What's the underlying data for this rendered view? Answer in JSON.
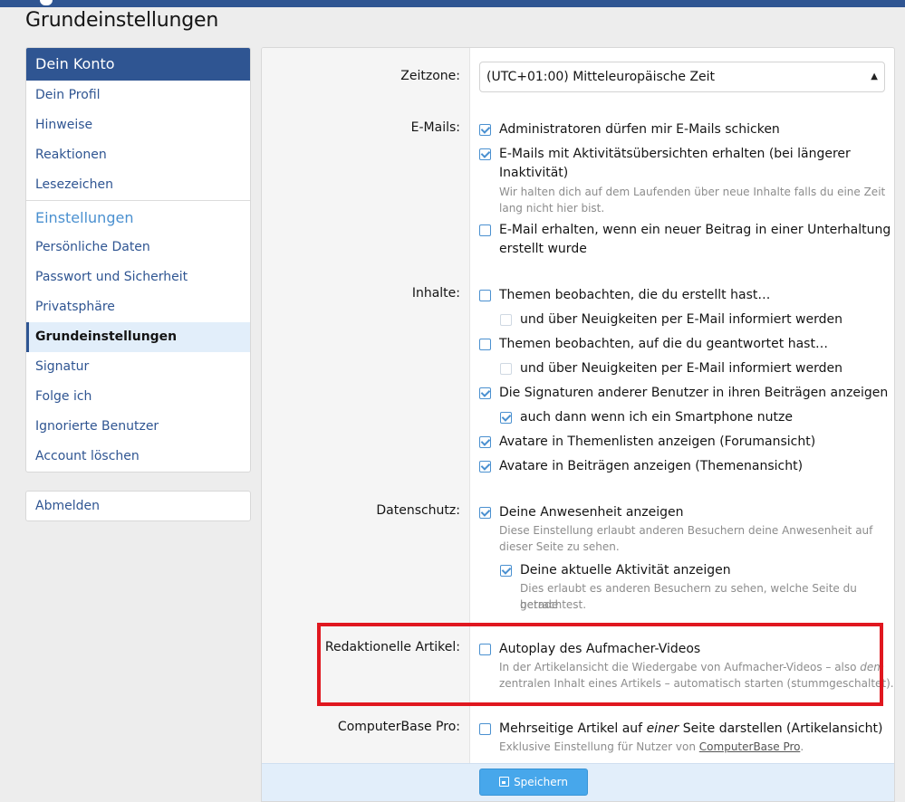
{
  "page_title": "Grundeinstellungen",
  "colors": {
    "brand": "#2f5592",
    "accent": "#4a90d0",
    "highlight": "#e0171f",
    "save": "#47a7eb"
  },
  "sidebar": {
    "header": "Dein Konto",
    "account_items": [
      {
        "label": "Dein Profil"
      },
      {
        "label": "Hinweise"
      },
      {
        "label": "Reaktionen"
      },
      {
        "label": "Lesezeichen"
      }
    ],
    "settings_group": "Einstellungen",
    "settings_items": [
      {
        "label": "Persönliche Daten"
      },
      {
        "label": "Passwort und Sicherheit"
      },
      {
        "label": "Privatsphäre"
      },
      {
        "label": "Grundeinstellungen",
        "active": true
      },
      {
        "label": "Signatur"
      },
      {
        "label": "Folge ich"
      },
      {
        "label": "Ignorierte Benutzer"
      },
      {
        "label": "Account löschen"
      }
    ],
    "logout": "Abmelden"
  },
  "form": {
    "timezone": {
      "label": "Zeitzone:",
      "value": "(UTC+01:00) Mitteleuropäische Zeit"
    },
    "emails": {
      "label": "E-Mails:",
      "options": [
        {
          "text": "Administratoren dürfen mir E-Mails schicken",
          "checked": true
        },
        {
          "text": "E-Mails mit Aktivitätsübersichten erhalten (bei längerer",
          "text2": "Inaktivität)",
          "checked": true,
          "hint": "Wir halten dich auf dem Laufenden über neue Inhalte falls du eine Zeit",
          "hint2": "lang nicht hier bist."
        },
        {
          "text": "E-Mail erhalten, wenn ein neuer Beitrag in einer Unterhaltung",
          "text2": "erstellt wurde",
          "checked": false
        }
      ]
    },
    "content": {
      "label": "Inhalte:",
      "options": [
        {
          "text": "Themen beobachten, die du erstellt hast…",
          "checked": false
        },
        {
          "text": "und über Neuigkeiten per E-Mail informiert werden",
          "checked": false,
          "disabled": true
        },
        {
          "text": "Themen beobachten, auf die du geantwortet hast…",
          "checked": false
        },
        {
          "text": "und über Neuigkeiten per E-Mail informiert werden",
          "checked": false,
          "disabled": true
        },
        {
          "text": "Die Signaturen anderer Benutzer in ihren Beiträgen anzeigen",
          "checked": true
        },
        {
          "text": "auch dann wenn ich ein Smartphone nutze",
          "checked": true
        },
        {
          "text": "Avatare in Themenlisten anzeigen (Forumansicht)",
          "checked": true
        },
        {
          "text": "Avatare in Beiträgen anzeigen (Themenansicht)",
          "checked": true
        }
      ]
    },
    "privacy": {
      "label": "Datenschutz:",
      "presence": {
        "text": "Deine Anwesenheit anzeigen",
        "checked": true,
        "hint": "Diese Einstellung erlaubt anderen Besuchern deine Anwesenheit auf",
        "hint2": "dieser Seite zu sehen."
      },
      "activity": {
        "text": "Deine aktuelle Aktivität anzeigen",
        "checked": true,
        "hint": "Dies erlaubt es anderen Besuchern zu sehen, welche Seite du gerade",
        "hint2": "betrachtest."
      }
    },
    "editorial": {
      "label": "Redaktionelle Artikel:",
      "text": "Autoplay des Aufmacher-Videos",
      "checked": false,
      "hint_a": "In der Artikelansicht die Wiedergabe von Aufmacher-Videos – also ",
      "hint_em": "dem",
      "hint2": "zentralen Inhalt eines Artikels – automatisch starten (stummgeschaltet)."
    },
    "pro": {
      "label": "ComputerBase Pro:",
      "text_a": "Mehrseitige Artikel auf ",
      "text_em": "einer",
      "text_b": " Seite darstellen (Artikelansicht)",
      "checked": false,
      "hint_a": "Exklusive Einstellung für Nutzer von ",
      "hint_link": "ComputerBase Pro",
      "hint_b": "."
    },
    "save_label": "Speichern"
  }
}
